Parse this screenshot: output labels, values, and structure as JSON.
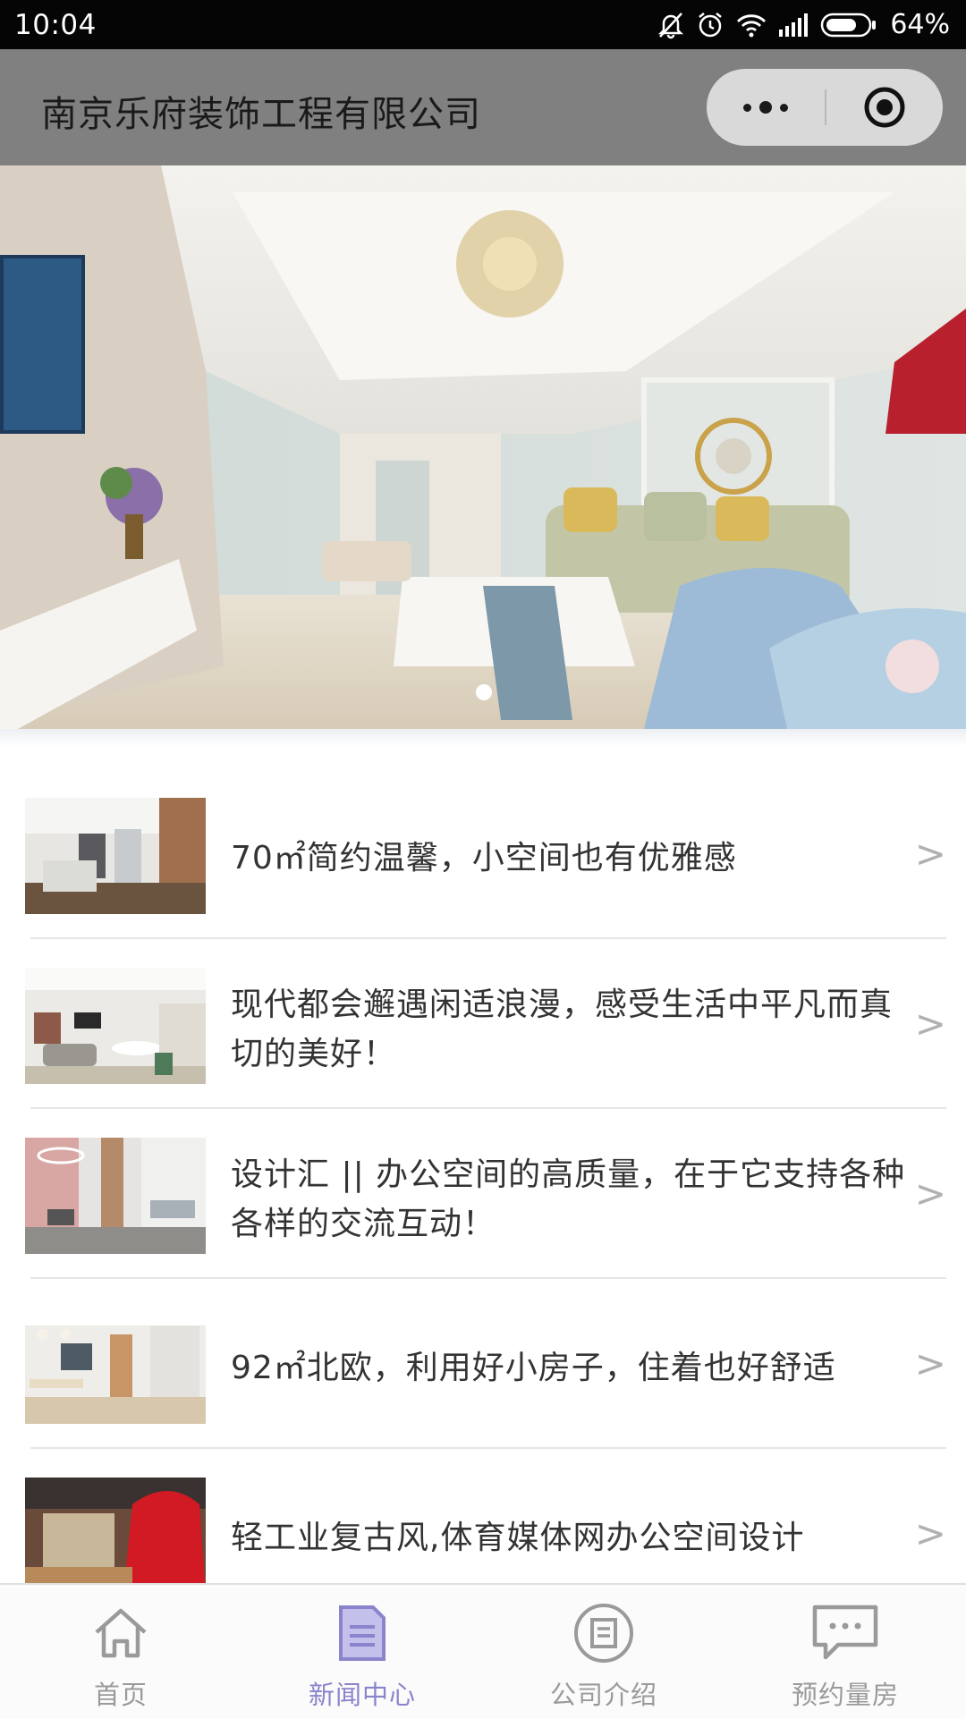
{
  "status_bar": {
    "time": "10:04",
    "battery": "64%",
    "icons": [
      "mute-bell-icon",
      "alarm-icon",
      "wifi-icon",
      "signal-icon",
      "battery-icon"
    ]
  },
  "nav": {
    "title": "南京乐府装饰工程有限公司",
    "capsule_icons": [
      "more-icon",
      "close-circle-icon"
    ]
  },
  "banner": {
    "slide_count": 1,
    "active_index": 0
  },
  "news": [
    {
      "title": "70㎡简约温馨，小空间也有优雅感",
      "arrow": ">"
    },
    {
      "title": "现代都会邂遇闲适浪漫，感受生活中平凡而真切的美好！",
      "arrow": ">"
    },
    {
      "title": "设计汇 || 办公空间的高质量，在于它支持各种各样的交流互动！",
      "arrow": ">"
    },
    {
      "title": "92㎡北欧，利用好小房子，住着也好舒适",
      "arrow": ">"
    },
    {
      "title": "轻工业复古风,体育媒体网办公空间设计",
      "arrow": ">"
    }
  ],
  "tabs": [
    {
      "label": "首页",
      "icon": "home-icon",
      "active": false
    },
    {
      "label": "新闻中心",
      "icon": "news-document-icon",
      "active": true
    },
    {
      "label": "公司介绍",
      "icon": "company-badge-icon",
      "active": false
    },
    {
      "label": "预约量房",
      "icon": "chat-bubble-icon",
      "active": false
    }
  ],
  "colors": {
    "status_bar": "#050505",
    "nav_bar": "#808080",
    "tab_active": "#8a84cc",
    "tab_inactive": "#9a9a9a"
  }
}
